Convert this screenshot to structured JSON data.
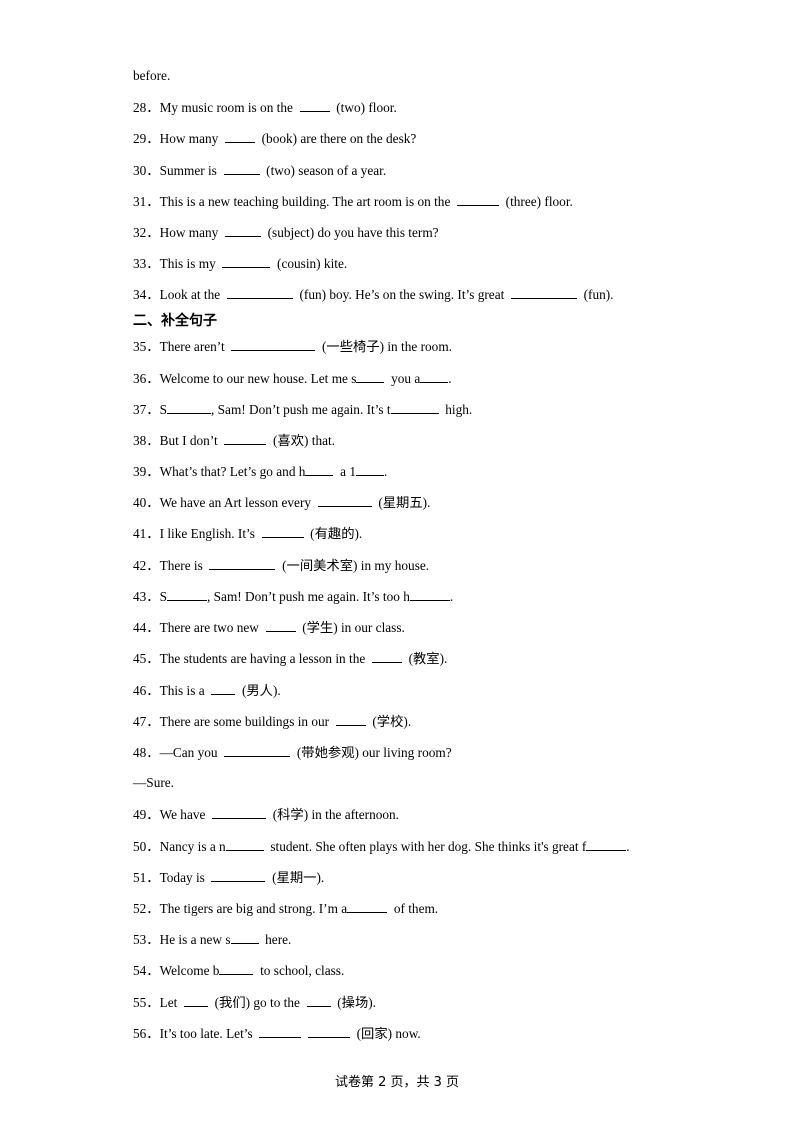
{
  "continuation": "before.",
  "section_heading": "二、补全句子",
  "items": [
    {
      "n": "28．",
      "parts": [
        [
          "t",
          "My music room is on the  "
        ],
        [
          "b",
          30
        ],
        [
          "t",
          "  (two) floor."
        ]
      ]
    },
    {
      "n": "29．",
      "parts": [
        [
          "t",
          "How many  "
        ],
        [
          "b",
          30
        ],
        [
          "t",
          "  (book) are there on the desk?"
        ]
      ]
    },
    {
      "n": "30．",
      "parts": [
        [
          "t",
          "Summer is  "
        ],
        [
          "b",
          36
        ],
        [
          "t",
          "  (two) season of a year."
        ]
      ]
    },
    {
      "n": "31．",
      "parts": [
        [
          "t",
          "This is a new teaching building. The art room is on the  "
        ],
        [
          "b",
          42
        ],
        [
          "t",
          "  (three) floor."
        ]
      ]
    },
    {
      "n": "32．",
      "parts": [
        [
          "t",
          "How many  "
        ],
        [
          "b",
          36
        ],
        [
          "t",
          "  (subject) do you have this term?"
        ]
      ]
    },
    {
      "n": "33．",
      "parts": [
        [
          "t",
          "This is my  "
        ],
        [
          "b",
          48
        ],
        [
          "t",
          "  (cousin) kite."
        ]
      ]
    },
    {
      "n": "34．",
      "parts": [
        [
          "t",
          "Look at the  "
        ],
        [
          "b",
          66
        ],
        [
          "t",
          "  (fun) boy. He’s on the swing. It’s great  "
        ],
        [
          "b",
          66
        ],
        [
          "t",
          "  (fun)."
        ]
      ]
    },
    {
      "heading": true
    },
    {
      "n": "35．",
      "parts": [
        [
          "t",
          "There aren’t  "
        ],
        [
          "b",
          84
        ],
        [
          "t",
          "  (一些椅子) in the room."
        ]
      ]
    },
    {
      "n": "36．",
      "parts": [
        [
          "t",
          "Welcome to our new house. Let me s"
        ],
        [
          "b",
          28
        ],
        [
          "t",
          "  you a"
        ],
        [
          "b",
          28
        ],
        [
          "t",
          "."
        ]
      ]
    },
    {
      "n": "37．",
      "parts": [
        [
          "t",
          "S"
        ],
        [
          "b",
          44
        ],
        [
          "t",
          ", Sam! Don’t push me again. It’s t"
        ],
        [
          "b",
          48
        ],
        [
          "t",
          "  high."
        ]
      ]
    },
    {
      "n": "38．",
      "parts": [
        [
          "t",
          "But I don’t  "
        ],
        [
          "b",
          42
        ],
        [
          "t",
          "  (喜欢) that."
        ]
      ]
    },
    {
      "n": "39．",
      "parts": [
        [
          "t",
          "What’s that? Let’s go and h"
        ],
        [
          "b",
          28
        ],
        [
          "t",
          "  a 1"
        ],
        [
          "b",
          28
        ],
        [
          "t",
          "."
        ]
      ]
    },
    {
      "n": "40．",
      "parts": [
        [
          "t",
          "We have an Art lesson every  "
        ],
        [
          "b",
          54
        ],
        [
          "t",
          "  (星期五)."
        ]
      ]
    },
    {
      "n": "41．",
      "parts": [
        [
          "t",
          "I like English. It’s  "
        ],
        [
          "b",
          42
        ],
        [
          "t",
          "  (有趣的)."
        ]
      ]
    },
    {
      "n": "42．",
      "parts": [
        [
          "t",
          "There is  "
        ],
        [
          "b",
          66
        ],
        [
          "t",
          "  (一间美术室) in my house."
        ]
      ]
    },
    {
      "n": "43．",
      "parts": [
        [
          "t",
          "S"
        ],
        [
          "b",
          40
        ],
        [
          "t",
          ", Sam! Don’t push me again. It’s too h"
        ],
        [
          "b",
          40
        ],
        [
          "t",
          "."
        ]
      ]
    },
    {
      "n": "44．",
      "parts": [
        [
          "t",
          "There are two new  "
        ],
        [
          "b",
          30
        ],
        [
          "t",
          "  (学生) in our class."
        ]
      ]
    },
    {
      "n": "45．",
      "parts": [
        [
          "t",
          "The students are having a lesson in the  "
        ],
        [
          "b",
          30
        ],
        [
          "t",
          "  (教室)."
        ]
      ]
    },
    {
      "n": "46．",
      "parts": [
        [
          "t",
          "This is a  "
        ],
        [
          "b",
          24
        ],
        [
          "t",
          "  (男人)."
        ]
      ]
    },
    {
      "n": "47．",
      "parts": [
        [
          "t",
          "There are some buildings in our  "
        ],
        [
          "b",
          30
        ],
        [
          "t",
          "  (学校)."
        ]
      ]
    },
    {
      "n": "48．",
      "parts": [
        [
          "t",
          "—Can you  "
        ],
        [
          "b",
          66
        ],
        [
          "t",
          "  (带她参观) our living room?"
        ]
      ]
    },
    {
      "n": "",
      "parts": [
        [
          "t",
          "—Sure."
        ]
      ]
    },
    {
      "n": "49．",
      "parts": [
        [
          "t",
          "We have  "
        ],
        [
          "b",
          54
        ],
        [
          "t",
          "  (科学) in the afternoon."
        ]
      ]
    },
    {
      "n": "50．",
      "parts": [
        [
          "t",
          "Nancy is a n"
        ],
        [
          "b",
          38
        ],
        [
          "t",
          "  student. She often plays with her dog. She thinks it's great f"
        ],
        [
          "b",
          40
        ],
        [
          "t",
          "."
        ]
      ]
    },
    {
      "n": "51．",
      "parts": [
        [
          "t",
          "Today is  "
        ],
        [
          "b",
          54
        ],
        [
          "t",
          "  (星期一)."
        ]
      ]
    },
    {
      "n": "52．",
      "parts": [
        [
          "t",
          "The tigers are big and strong. I’m a"
        ],
        [
          "b",
          40
        ],
        [
          "t",
          "  of them."
        ]
      ]
    },
    {
      "n": "53．",
      "parts": [
        [
          "t",
          "He is a new s"
        ],
        [
          "b",
          28
        ],
        [
          "t",
          "  here."
        ]
      ]
    },
    {
      "n": "54．",
      "parts": [
        [
          "t",
          "Welcome b"
        ],
        [
          "b",
          34
        ],
        [
          "t",
          "  to school, class."
        ]
      ]
    },
    {
      "n": "55．",
      "parts": [
        [
          "t",
          "Let  "
        ],
        [
          "b",
          24
        ],
        [
          "t",
          "  (我们) go to the  "
        ],
        [
          "b",
          24
        ],
        [
          "t",
          "  (操场)."
        ]
      ]
    },
    {
      "n": "56．",
      "parts": [
        [
          "t",
          "It’s too late. Let’s  "
        ],
        [
          "b",
          42
        ],
        [
          "t",
          "  "
        ],
        [
          "b",
          42
        ],
        [
          "t",
          "  (回家) now."
        ]
      ]
    }
  ],
  "footer": "试卷第 2 页，共 3 页"
}
